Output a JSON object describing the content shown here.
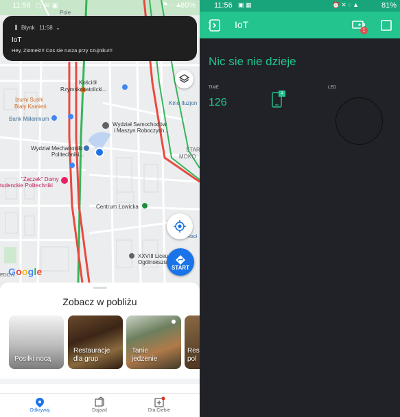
{
  "left_phone": {
    "status_bar": {
      "time": "11:58",
      "battery": "80%"
    },
    "notification": {
      "app": "Blynk",
      "time": "11:58",
      "title": "IoT",
      "message": "Hey, Ziomek!!!   Cos sie rusza przy czujniku!!!"
    },
    "map": {
      "labels": {
        "pole": "Pole",
        "kosciol": "Kościół",
        "rzymsko": "Rzymskokatolicki...",
        "izumi1": "Izumi Sushi",
        "izumi2": "Biały Kamień",
        "kino": "Kino Iluzjon",
        "bank": "Bank Millennium",
        "wydzial_sam1": "Wydział Samochodów",
        "wydzial_sam2": "i Maszyn Roboczych...",
        "wydzial_mech1": "Wydział Mechatroniki",
        "wydzial_mech2": "Politechniki...",
        "star": "STAR",
        "moko": "MOKO",
        "zaczek1": "\"Żaczek\" Domy",
        "zaczek2": "tudenckie Politechniki",
        "centrum": "Centrum Łowicka",
        "liceum1": "XXVIII Liceum",
        "liceum2": "Ogólnokszta...",
        "racl": "Racł",
        "edow": "EDOW",
        "google": "Google"
      },
      "start_label": "START"
    },
    "sheet": {
      "title": "Zobacz w pobliżu",
      "cards": [
        {
          "label_line1": "Posiłki nocą",
          "label_line2": ""
        },
        {
          "label_line1": "Restauracje",
          "label_line2": "dla grup"
        },
        {
          "label_line1": "Tanie",
          "label_line2": "jedzenie"
        },
        {
          "label_line1": "Res",
          "label_line2": "pol"
        }
      ]
    },
    "bottom_nav": [
      {
        "label": "Odkrywaj",
        "active": true
      },
      {
        "label": "Dojazd",
        "active": false
      },
      {
        "label": "Dla Ciebie",
        "active": false
      }
    ]
  },
  "right_phone": {
    "status_bar": {
      "time": "11:56",
      "battery": "81%"
    },
    "toolbar": {
      "title": "IoT",
      "notification_count": "1"
    },
    "project_title": "Nic sie nie dzieje",
    "widgets": {
      "time_label": "TIME",
      "time_value": "126",
      "device_badge": "1",
      "led_label": "LED"
    },
    "colors": {
      "accent": "#23c48e",
      "background": "#212227"
    }
  }
}
